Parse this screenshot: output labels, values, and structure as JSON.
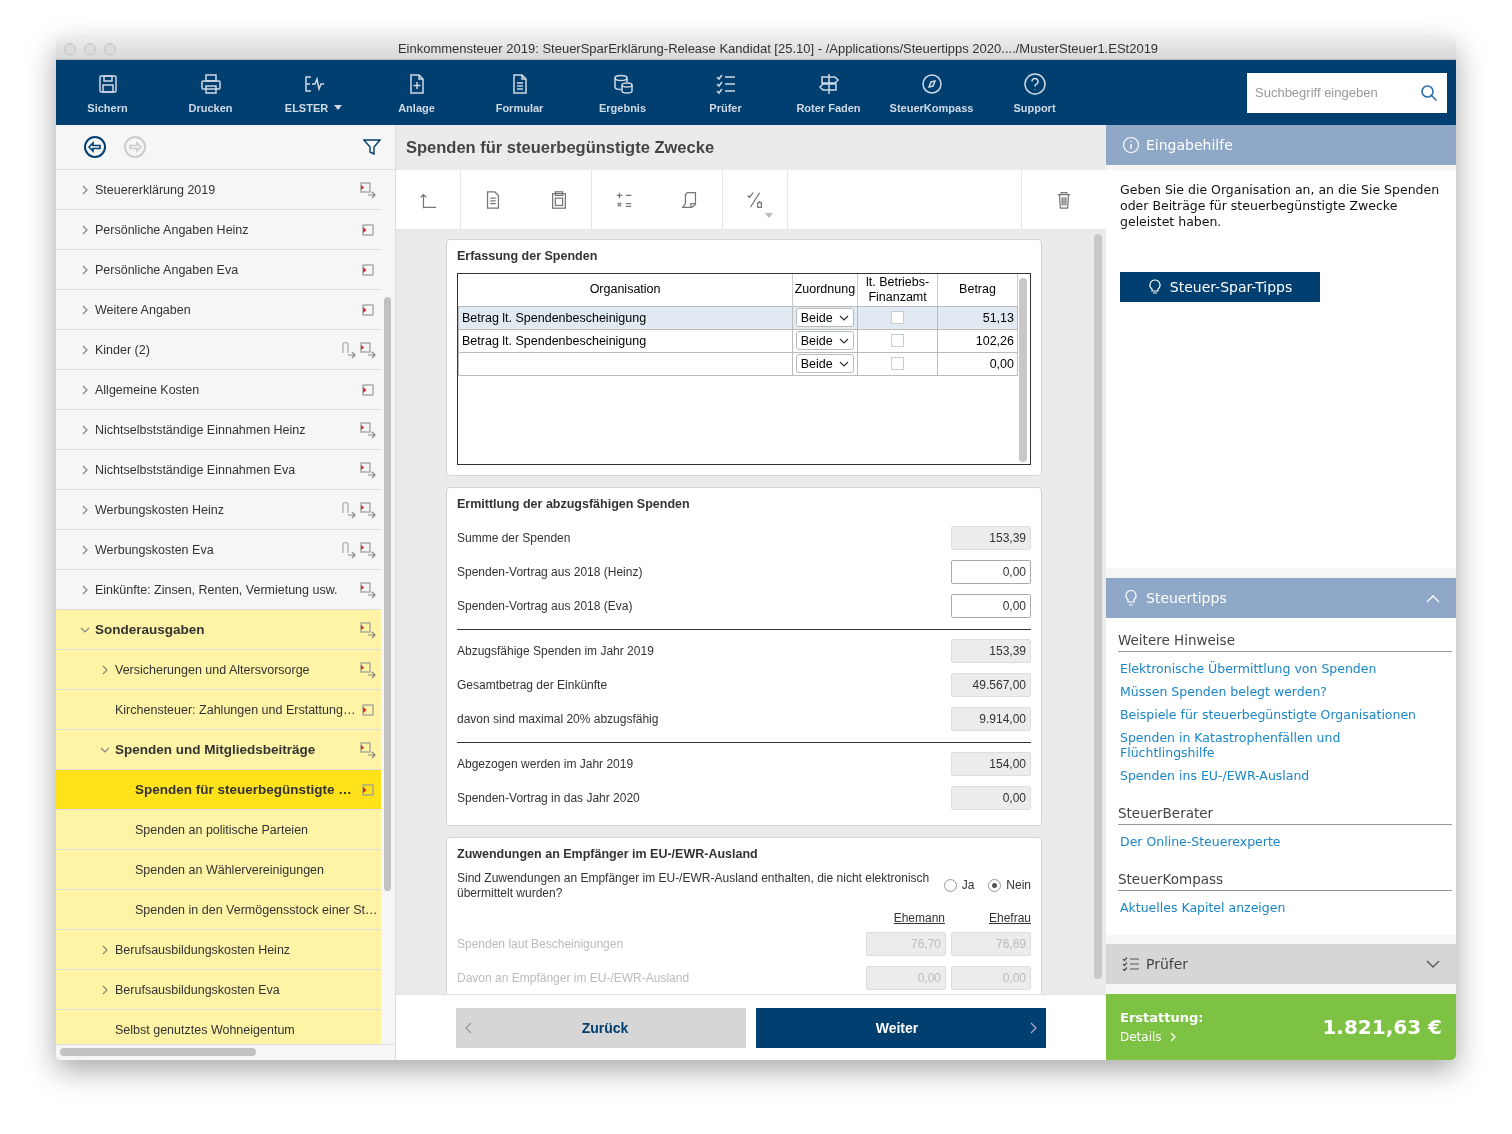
{
  "window": {
    "title": "Einkommensteuer 2019: SteuerSparErklärung-Release Kandidat [25.10] - /Applications/Steuertipps 2020..../MusterSteuer1.ESt2019"
  },
  "toolbar": {
    "items": [
      {
        "label": "Sichern",
        "dropdown": false
      },
      {
        "label": "Drucken",
        "dropdown": false
      },
      {
        "label": "ELSTER",
        "dropdown": true
      },
      {
        "label": "Anlage",
        "dropdown": false
      },
      {
        "label": "Formular",
        "dropdown": false
      },
      {
        "label": "Ergebnis",
        "dropdown": false
      },
      {
        "label": "Prüfer",
        "dropdown": false
      },
      {
        "label": "Roter Faden",
        "dropdown": false
      },
      {
        "label": "SteuerKompass",
        "dropdown": false
      },
      {
        "label": "Support",
        "dropdown": false
      }
    ],
    "search": {
      "placeholder": "Suchbegriff eingeben"
    }
  },
  "sidebar": {
    "tree": [
      {
        "label": "Steuererklärung 2019",
        "expanded": false,
        "form": true,
        "forward": true,
        "attachment": false,
        "selected": false,
        "active_branch": false
      },
      {
        "label": "Persönliche Angaben Heinz",
        "expanded": false,
        "form": true,
        "forward": false,
        "attachment": false,
        "selected": false,
        "active_branch": false
      },
      {
        "label": "Persönliche Angaben Eva",
        "expanded": false,
        "form": true,
        "forward": false,
        "attachment": false,
        "selected": false,
        "active_branch": false
      },
      {
        "label": "Weitere Angaben",
        "expanded": false,
        "form": true,
        "forward": false,
        "attachment": false,
        "selected": false,
        "active_branch": false
      },
      {
        "label": "Kinder (2)",
        "expanded": false,
        "form": true,
        "forward": true,
        "attachment": true,
        "selected": false,
        "active_branch": false
      },
      {
        "label": "Allgemeine Kosten",
        "expanded": false,
        "form": true,
        "forward": false,
        "attachment": false,
        "selected": false,
        "active_branch": false
      },
      {
        "label": "Nichtselbstständige Einnahmen Heinz",
        "expanded": false,
        "form": true,
        "forward": true,
        "attachment": false,
        "selected": false,
        "active_branch": false
      },
      {
        "label": "Nichtselbstständige Einnahmen Eva",
        "expanded": false,
        "form": true,
        "forward": true,
        "attachment": false,
        "selected": false,
        "active_branch": false
      },
      {
        "label": "Werbungskosten Heinz",
        "expanded": false,
        "form": true,
        "forward": true,
        "attachment": true,
        "selected": false,
        "active_branch": false
      },
      {
        "label": "Werbungskosten Eva",
        "expanded": false,
        "form": true,
        "forward": true,
        "attachment": true,
        "selected": false,
        "active_branch": false
      },
      {
        "label": "Einkünfte: Zinsen, Renten, Vermietung usw.",
        "expanded": false,
        "form": true,
        "forward": true,
        "attachment": false,
        "selected": false,
        "active_branch": false
      },
      {
        "label": "Sonderausgaben",
        "expanded": true,
        "form": true,
        "forward": true,
        "attachment": false,
        "selected": false,
        "active_branch": true,
        "children": [
          {
            "label": "Versicherungen und Altersvorsorge",
            "expanded": false,
            "form": true,
            "forward": true,
            "attachment": false,
            "selected": false
          },
          {
            "label": "Kirchensteuer: Zahlungen und Erstattung…",
            "form": true,
            "forward": false,
            "attachment": false,
            "selected": false
          },
          {
            "label": "Spenden und Mitgliedsbeiträge",
            "expanded": true,
            "form": true,
            "forward": true,
            "attachment": false,
            "selected": false,
            "children": [
              {
                "label": "Spenden für steuerbegünstigte …",
                "form": true,
                "forward": false,
                "attachment": false,
                "selected": true
              },
              {
                "label": "Spenden an politische Parteien",
                "form": false,
                "forward": false,
                "attachment": false,
                "selected": false
              },
              {
                "label": "Spenden an Wählervereinigungen",
                "form": false,
                "forward": false,
                "attachment": false,
                "selected": false
              },
              {
                "label": "Spenden in den Vermögensstock einer St…",
                "selected": false
              }
            ]
          },
          {
            "label": "Berufsausbildungskosten Heinz",
            "expanded": false,
            "form": false,
            "forward": false,
            "attachment": false,
            "selected": false
          },
          {
            "label": "Berufsausbildungskosten Eva",
            "expanded": false,
            "form": false,
            "forward": false,
            "attachment": false,
            "selected": false
          },
          {
            "label": "Selbst genutztes Wohneigentum",
            "form": false,
            "forward": false,
            "attachment": false,
            "selected": false
          }
        ]
      }
    ]
  },
  "page": {
    "title": "Spenden für steuerbegünstigte Zwecke"
  },
  "donations": {
    "title": "Erfassung der Spenden",
    "columns": [
      "Organisation",
      "Zuordnung",
      "lt. Betriebs-Finanzamt",
      "Betrag"
    ],
    "rows": [
      {
        "organisation": "Betrag lt. Spendenbescheinigung",
        "assignment": "Beide",
        "checked": false,
        "amount": "51,13",
        "selected": true
      },
      {
        "organisation": "Betrag lt. Spendenbescheinigung",
        "assignment": "Beide",
        "checked": false,
        "amount": "102,26",
        "selected": false
      },
      {
        "assignment": "Beide",
        "checked": false,
        "amount": "0,00",
        "selected": false
      }
    ]
  },
  "calculation": {
    "title": "Ermittlung der abzugsfähigen Spenden",
    "groups": [
      [
        {
          "label": "Summe der Spenden",
          "value": "153,39",
          "kind": "readonly"
        },
        {
          "label": "Spenden-Vortrag aus 2018 (Heinz)",
          "value": "0,00",
          "kind": "input"
        },
        {
          "label": "Spenden-Vortrag aus 2018 (Eva)",
          "value": "0,00",
          "kind": "input"
        }
      ],
      [
        {
          "label": "Abzugsfähige Spenden im Jahr 2019",
          "value": "153,39",
          "kind": "readonly"
        },
        {
          "label": "Gesamtbetrag der Einkünfte",
          "value": "49.567,00",
          "kind": "readonly"
        },
        {
          "label": "davon sind maximal 20% abzugsfähig",
          "value": "9.914,00",
          "kind": "readonly"
        }
      ],
      [
        {
          "label": "Abgezogen werden im Jahr 2019",
          "value": "154,00",
          "kind": "readonly"
        },
        {
          "label": "Spenden-Vortrag in das Jahr 2020",
          "value": "0,00",
          "kind": "readonly"
        }
      ]
    ]
  },
  "abroad": {
    "title": "Zuwendungen an Empfänger im EU-/EWR-Ausland",
    "question": "Sind Zuwendungen an Empfänger im EU-/EWR-Ausland enthalten, die nicht elektronisch übermittelt wurden?",
    "options": [
      {
        "label": "Ja",
        "selected": false
      },
      {
        "label": "Nein",
        "selected": true
      }
    ],
    "columns": [
      "Ehemann",
      "Ehefrau"
    ],
    "rows": [
      {
        "label": "Spenden laut Bescheinigungen",
        "values": [
          "76,70",
          "76,69"
        ],
        "disabled": true
      },
      {
        "label": "Davon an Empfänger im EU-/EWR-Ausland",
        "values": [
          "0,00",
          "0,00"
        ],
        "disabled": true
      }
    ]
  },
  "nav": {
    "back": "Zurück",
    "next": "Weiter"
  },
  "help": {
    "title": "Eingabehilfe",
    "text": "Geben Sie die Organisation an, an die Sie Spenden oder Beiträge für steuerbegünstigte Zwecke geleistet haben.",
    "button": "Steuer-Spar-Tipps"
  },
  "tips": {
    "title": "Steuertipps",
    "expanded": true,
    "sections": [
      {
        "heading": "Weitere Hinweise",
        "links": [
          "Elektronische Übermittlung von Spenden",
          "Müssen Spenden belegt werden?",
          "Beispiele für steuerbegünstigte Organisationen",
          "Spenden in Katastrophenfällen und Flüchtlingshilfe",
          "Spenden ins EU-/EWR-Ausland"
        ]
      },
      {
        "heading": "SteuerBerater",
        "links": [
          "Der Online-Steuerexperte"
        ]
      },
      {
        "heading": "SteuerKompass",
        "links": [
          "Aktuelles Kapitel anzeigen"
        ]
      }
    ]
  },
  "checker": {
    "title": "Prüfer",
    "expanded": false
  },
  "refund": {
    "label": "Erstattung:",
    "details": "Details",
    "amount": "1.821,63 €"
  }
}
